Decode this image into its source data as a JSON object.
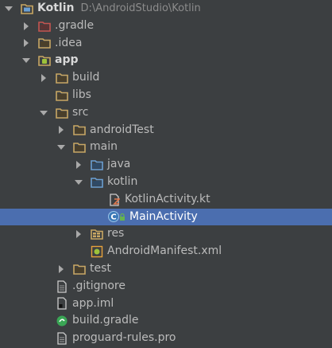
{
  "tree": {
    "items": [
      {
        "label": "Kotlin",
        "path": "D:\\AndroidStudio\\Kotlin",
        "depth": 0,
        "arrow": "down",
        "icon": "module-folder-icon",
        "bold": true
      },
      {
        "label": ".gradle",
        "depth": 1,
        "arrow": "right",
        "icon": "excluded-folder-icon"
      },
      {
        "label": ".idea",
        "depth": 1,
        "arrow": "right",
        "icon": "folder-icon"
      },
      {
        "label": "app",
        "depth": 1,
        "arrow": "down",
        "icon": "android-module-icon",
        "bold": true
      },
      {
        "label": "build",
        "depth": 2,
        "arrow": "right",
        "icon": "folder-icon"
      },
      {
        "label": "libs",
        "depth": 2,
        "arrow": "none",
        "icon": "folder-icon"
      },
      {
        "label": "src",
        "depth": 2,
        "arrow": "down",
        "icon": "folder-icon"
      },
      {
        "label": "androidTest",
        "depth": 3,
        "arrow": "right",
        "icon": "folder-icon"
      },
      {
        "label": "main",
        "depth": 3,
        "arrow": "down",
        "icon": "folder-icon"
      },
      {
        "label": "java",
        "depth": 4,
        "arrow": "right",
        "icon": "source-folder-icon"
      },
      {
        "label": "kotlin",
        "depth": 4,
        "arrow": "down",
        "icon": "source-folder-icon"
      },
      {
        "label": "KotlinActivity.kt",
        "depth": 5,
        "arrow": "none",
        "icon": "kotlin-file-icon"
      },
      {
        "label": "MainActivity",
        "depth": 5,
        "arrow": "none",
        "icon": "class-icon",
        "selected": true
      },
      {
        "label": "res",
        "depth": 4,
        "arrow": "right",
        "icon": "resource-folder-icon"
      },
      {
        "label": "AndroidManifest.xml",
        "depth": 4,
        "arrow": "none",
        "icon": "manifest-file-icon"
      },
      {
        "label": "test",
        "depth": 3,
        "arrow": "right",
        "icon": "folder-icon"
      },
      {
        "label": ".gitignore",
        "depth": 2,
        "arrow": "none",
        "icon": "text-file-icon"
      },
      {
        "label": "app.iml",
        "depth": 2,
        "arrow": "none",
        "icon": "iml-file-icon"
      },
      {
        "label": "build.gradle",
        "depth": 2,
        "arrow": "none",
        "icon": "gradle-file-icon"
      },
      {
        "label": "proguard-rules.pro",
        "depth": 2,
        "arrow": "none",
        "icon": "text-file-icon"
      }
    ]
  },
  "colors": {
    "background": "#3c3f41",
    "selection": "#4b6eaf",
    "text": "#bbbbbb",
    "folder": "#c9a763",
    "source_folder": "#6a9fd4",
    "excluded_folder": "#c75450"
  }
}
